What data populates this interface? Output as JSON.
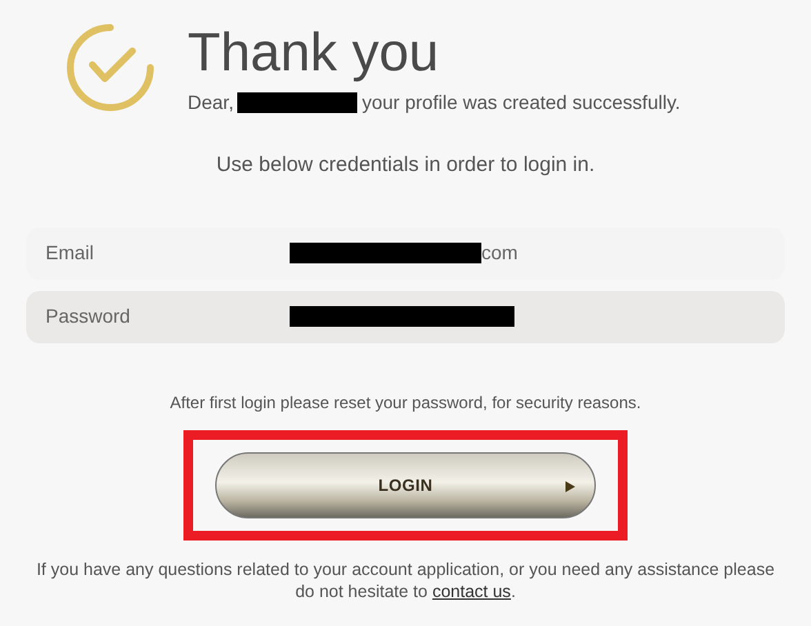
{
  "header": {
    "title": "Thank you",
    "greeting": "Dear,",
    "message": "your profile was created successfully."
  },
  "instruction": "Use below credentials in order to login in.",
  "credentials": [
    {
      "label": "Email",
      "value_suffix": "com",
      "shaded": false
    },
    {
      "label": "Password",
      "shaded": true
    }
  ],
  "note": "After first login please reset your password, for security reasons.",
  "login_button": {
    "label": "LOGIN",
    "highlighted": true
  },
  "footer": {
    "text": "If you have any questions related to your account application, or you need any assistance please do not hesitate to ",
    "link": "contact us",
    "after": "."
  }
}
